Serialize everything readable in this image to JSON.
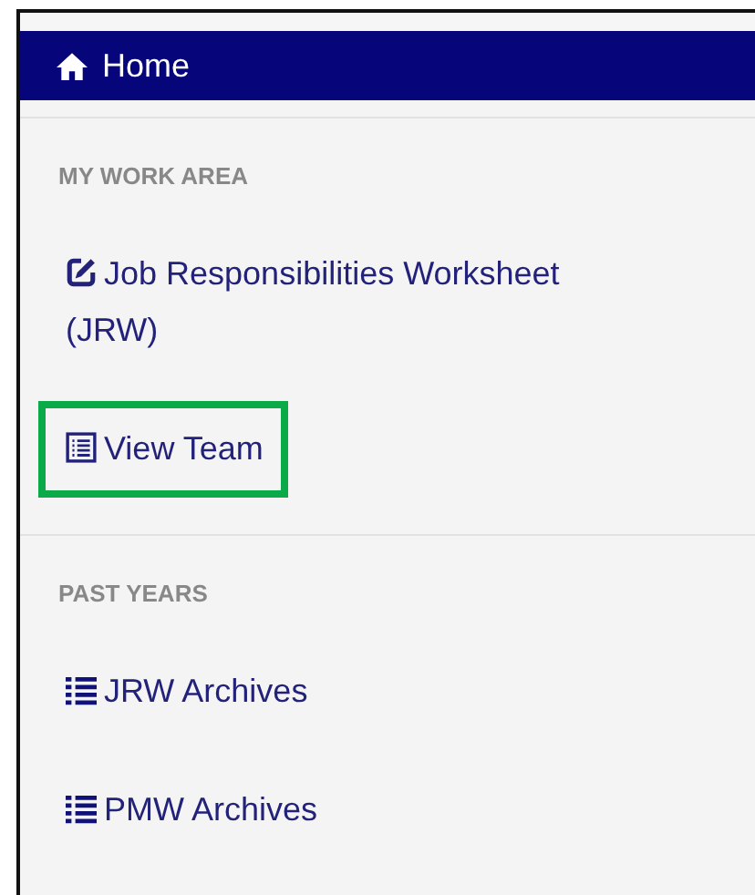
{
  "home": {
    "label": "Home"
  },
  "sections": [
    {
      "title": "MY WORK AREA",
      "items": [
        {
          "label": "Job Responsibilities Worksheet (JRW)",
          "kind": "edit",
          "highlighted": false
        },
        {
          "label": "View Team",
          "kind": "list-alt",
          "highlighted": true
        }
      ]
    },
    {
      "title": "PAST YEARS",
      "items": [
        {
          "label": "JRW Archives",
          "kind": "list",
          "highlighted": false
        },
        {
          "label": "PMW Archives",
          "kind": "list",
          "highlighted": false
        }
      ]
    }
  ]
}
